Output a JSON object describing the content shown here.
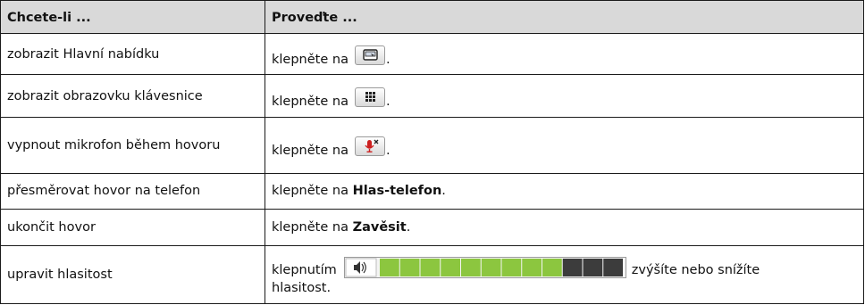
{
  "table": {
    "header": {
      "col1": "Chcete-li ...",
      "col2": "Proveďte ..."
    },
    "rows": [
      {
        "want": "zobrazit Hlavní nabídku",
        "action_prefix": "klepněte na",
        "icon": "main-menu-icon",
        "suffix": "."
      },
      {
        "want": "zobrazit obrazovku klávesnice",
        "action_prefix": "klepněte na",
        "icon": "keypad-icon",
        "suffix": "."
      },
      {
        "want": "vypnout mikrofon během hovoru",
        "action_prefix": "klepněte na",
        "icon": "mute-microphone-icon",
        "suffix": "."
      },
      {
        "want": "přesměrovat hovor na telefon",
        "action_prefix": "klepněte na ",
        "bold": "Hlas-telefon",
        "suffix": "."
      },
      {
        "want": "ukončit hovor",
        "action_prefix": "klepněte na ",
        "bold": "Zavěsit",
        "suffix": "."
      },
      {
        "want": "upravit hlasitost",
        "action_prefix": "klepnutím",
        "icon": "volume-slider",
        "suffix_line1": "zvýšíte nebo snížíte",
        "suffix_line2": "hlasitost.",
        "volume_level": 0.75
      }
    ]
  },
  "colors": {
    "header_bg": "#d9d9d9",
    "volume_green": "#8cc63f",
    "volume_dark": "#3c3c3c",
    "mute_red": "#cc1f1f"
  }
}
